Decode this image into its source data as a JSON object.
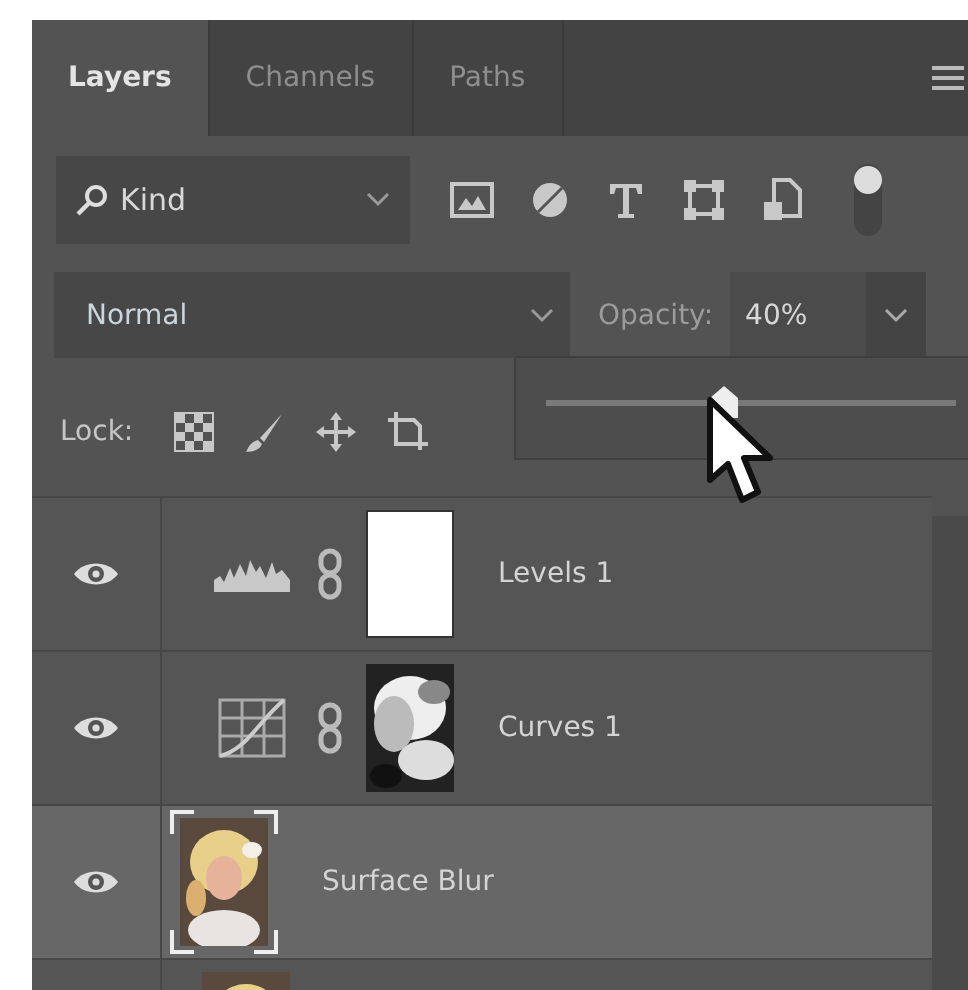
{
  "tabs": [
    {
      "label": "Layers",
      "selected": true
    },
    {
      "label": "Channels",
      "selected": false
    },
    {
      "label": "Paths",
      "selected": false
    }
  ],
  "filter": {
    "value": "Kind"
  },
  "blend_mode": {
    "value": "Normal"
  },
  "opacity": {
    "label": "Opacity:",
    "value": "40%"
  },
  "opacity_slider": {
    "level": 0.4
  },
  "lock": {
    "label": "Lock:"
  },
  "layers": [
    {
      "name": "Levels 1",
      "kind": "levels",
      "visible": true,
      "selected": false
    },
    {
      "name": "Curves 1",
      "kind": "curves",
      "visible": true,
      "selected": false
    },
    {
      "name": "Surface Blur",
      "kind": "pixel",
      "visible": true,
      "selected": true
    },
    {
      "kind": "pixel",
      "selected": false
    }
  ]
}
